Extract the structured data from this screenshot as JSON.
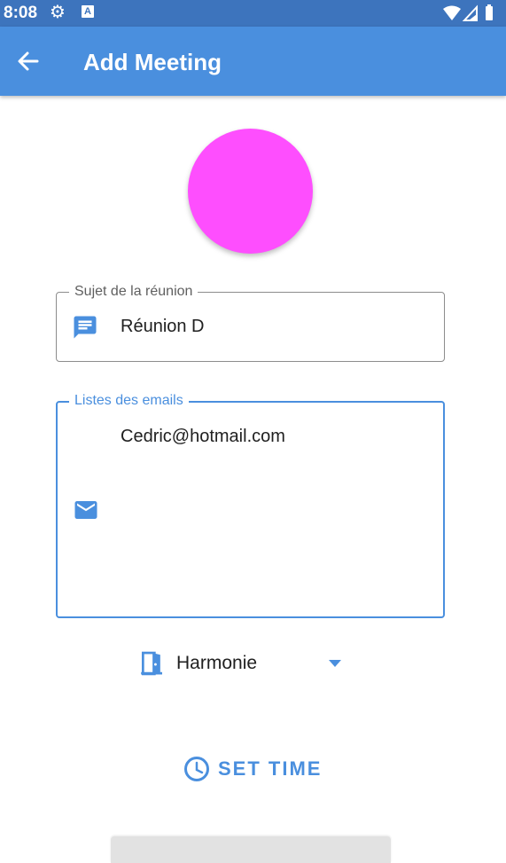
{
  "status_bar": {
    "time": "8:08",
    "icons": [
      "gear-icon",
      "a-badge-icon",
      "wifi-icon",
      "signal-icon",
      "battery-icon"
    ]
  },
  "app_bar": {
    "title": "Add Meeting",
    "back_icon": "arrow-back-icon",
    "color": "#4a8fde"
  },
  "avatar": {
    "color": "#fe4efe"
  },
  "subject_field": {
    "label": "Sujet de la réunion",
    "value": "Réunion D",
    "icon": "message-icon"
  },
  "emails_field": {
    "label": "Listes des emails",
    "value": "Cedric@hotmail.com",
    "icon": "email-icon"
  },
  "room_select": {
    "value": "Harmonie",
    "icon": "door-icon",
    "dropdown_icon": "arrow-drop-down-icon"
  },
  "set_time_button": {
    "label": "SET TIME",
    "icon": "clock-icon"
  },
  "colors": {
    "primary": "#4a8fde",
    "status_bar": "#3d74bd",
    "avatar": "#fe4efe"
  }
}
